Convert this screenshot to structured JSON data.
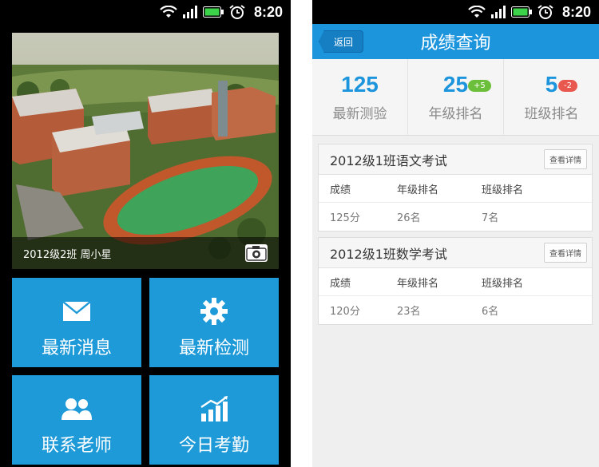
{
  "status": {
    "time": "8:20"
  },
  "left": {
    "hero": {
      "caption": "2012级2班 周小星"
    },
    "tiles": [
      {
        "label": "最新消息",
        "icon": "envelope-icon"
      },
      {
        "label": "最新检测",
        "icon": "gear-icon"
      },
      {
        "label": "联系老师",
        "icon": "contacts-icon"
      },
      {
        "label": "今日考勤",
        "icon": "chart-icon"
      }
    ]
  },
  "right": {
    "back_label": "返回",
    "title": "成绩查询",
    "stats": [
      {
        "value": "125",
        "label": "最新测验",
        "badge": ""
      },
      {
        "value": "25",
        "label": "年级排名",
        "badge": "+5"
      },
      {
        "value": "5",
        "label": "班级排名",
        "badge": "-2"
      }
    ],
    "cards": [
      {
        "title": "2012级1班语文考试",
        "detail_label": "查看详情",
        "headers": [
          "成绩",
          "年级排名",
          "班级排名"
        ],
        "values": [
          "125分",
          "26名",
          "7名"
        ]
      },
      {
        "title": "2012级1班数学考试",
        "detail_label": "查看详情",
        "headers": [
          "成绩",
          "年级排名",
          "班级排名"
        ],
        "values": [
          "120分",
          "23名",
          "6名"
        ]
      }
    ]
  },
  "colors": {
    "accent": "#1d95dd",
    "tile": "#1e9ad8",
    "badge_up": "#6bbf3a",
    "badge_down": "#e8584f"
  }
}
